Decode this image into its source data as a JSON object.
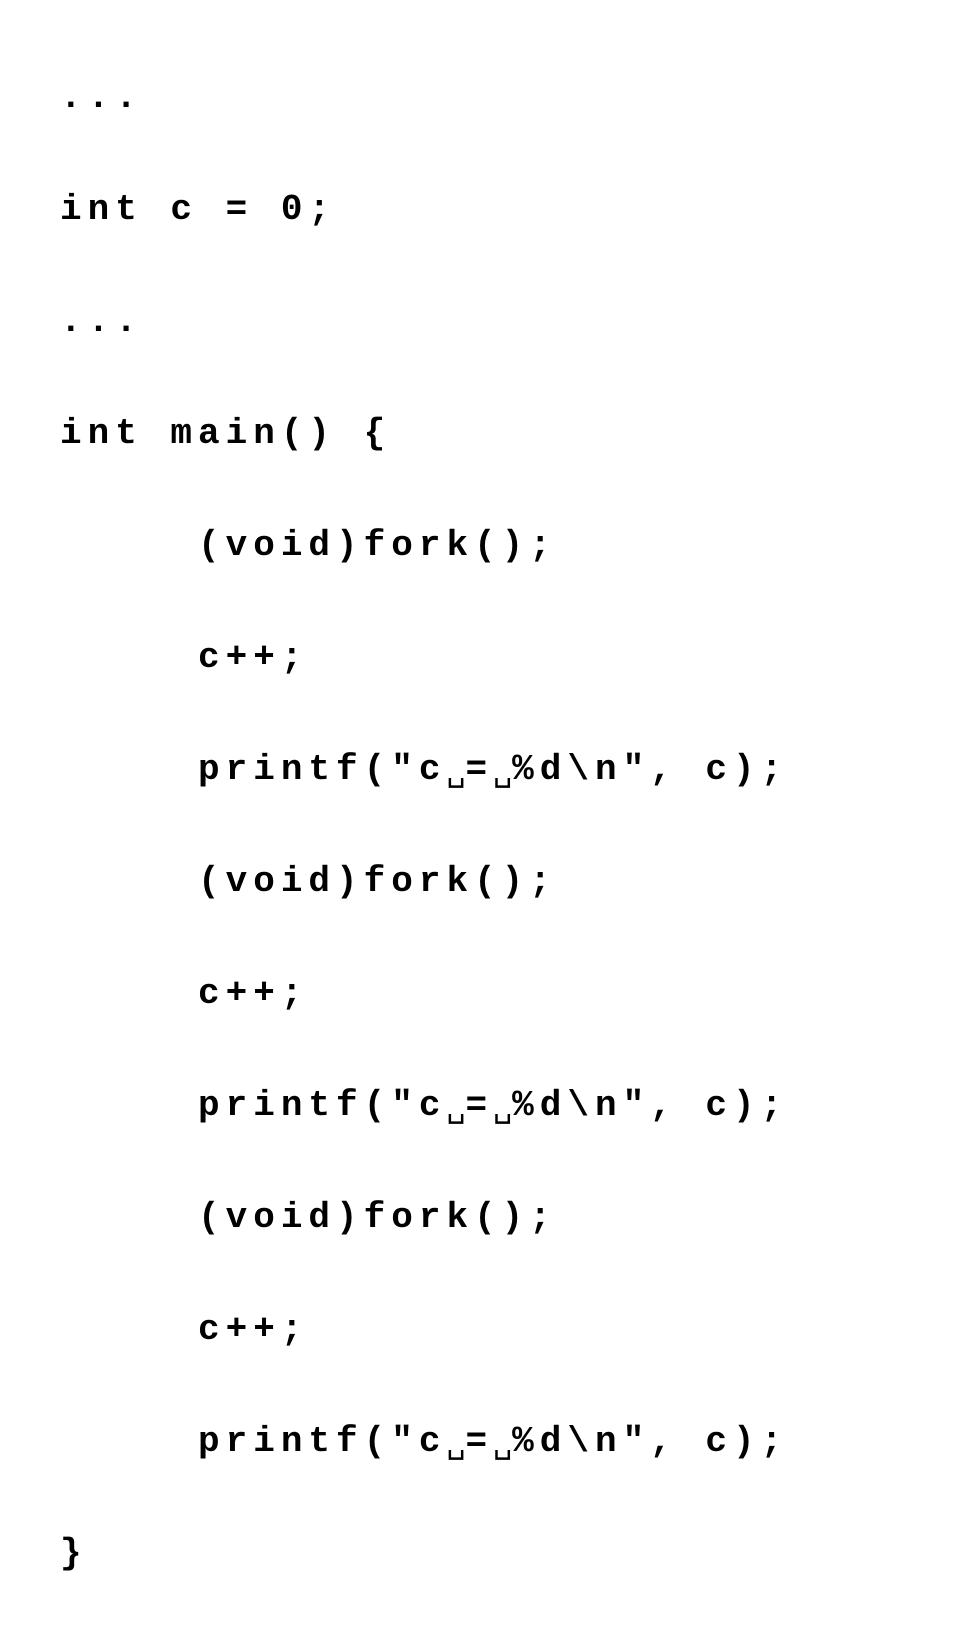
{
  "visible_space": "␣",
  "code": {
    "lines": [
      "...",
      "int c = 0;",
      "...",
      "int main() {",
      "     (void)fork();",
      "     c++;",
      "     printf(\"c␣=␣%d\\n\", c);",
      "     (void)fork();",
      "     c++;",
      "     printf(\"c␣=␣%d\\n\", c);",
      "     (void)fork();",
      "     c++;",
      "     printf(\"c␣=␣%d\\n\", c);",
      "}"
    ]
  }
}
